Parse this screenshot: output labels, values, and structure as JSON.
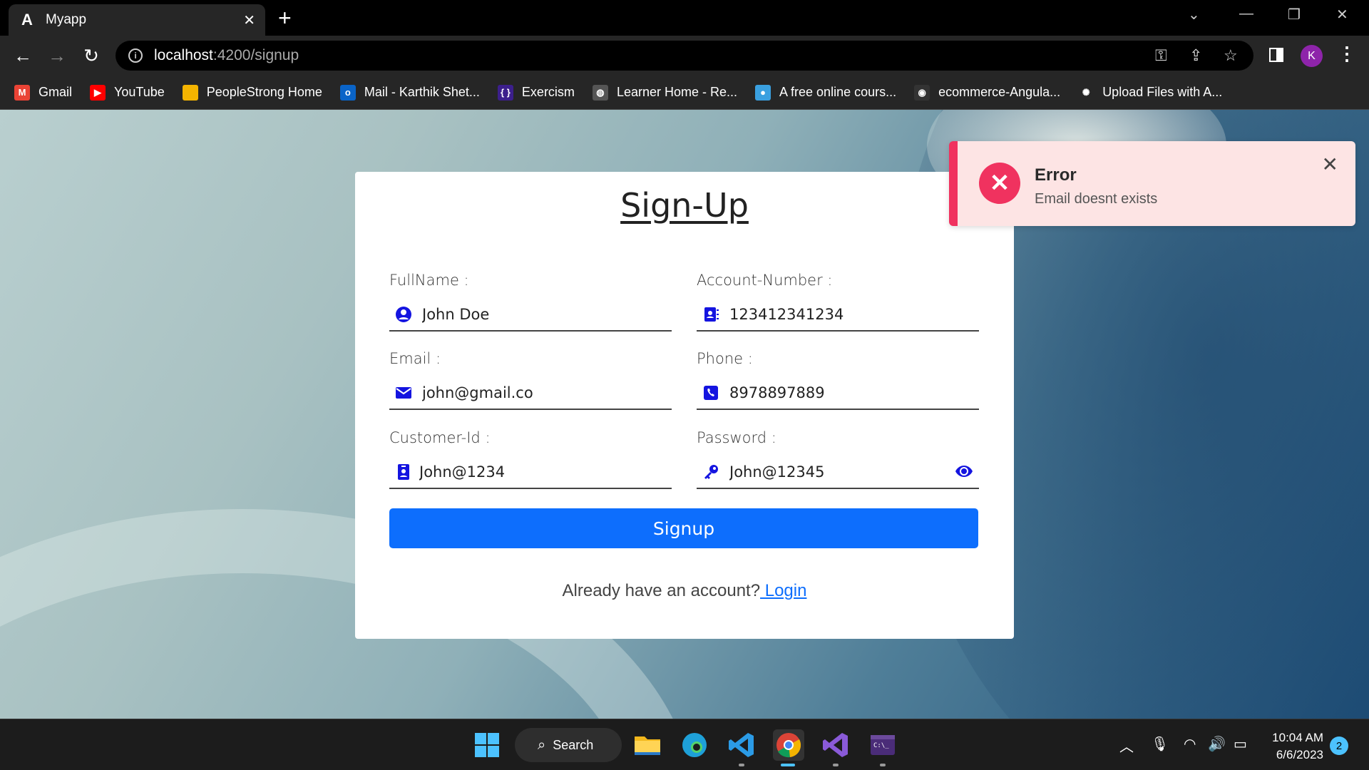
{
  "browser": {
    "tab": {
      "favicon_letter": "A",
      "title": "Myapp",
      "close": "✕"
    },
    "new_tab": "+",
    "url_host": "localhost",
    "url_path": ":4200/signup",
    "profile_initial": "K",
    "bookmarks": [
      {
        "label": "Gmail",
        "icon": "gmail-icon",
        "color": "#ea4335",
        "glyph": "M"
      },
      {
        "label": "YouTube",
        "icon": "youtube-icon",
        "color": "#ff0000",
        "glyph": "▶"
      },
      {
        "label": "PeopleStrong Home",
        "icon": "peoplestrong-icon",
        "color": "#f4b400",
        "glyph": ""
      },
      {
        "label": "Mail - Karthik Shet...",
        "icon": "outlook-icon",
        "color": "#0a64c8",
        "glyph": "o"
      },
      {
        "label": "Exercism",
        "icon": "exercism-icon",
        "color": "#3c1f8c",
        "glyph": "{ }"
      },
      {
        "label": "Learner Home - Re...",
        "icon": "globe-icon",
        "color": "#555555",
        "glyph": "◍"
      },
      {
        "label": "A free online cours...",
        "icon": "course-icon",
        "color": "#3aa0e0",
        "glyph": "●"
      },
      {
        "label": "ecommerce-Angula...",
        "icon": "github-icon",
        "color": "#333333",
        "glyph": "◉"
      },
      {
        "label": "Upload Files with A...",
        "icon": "upload-icon",
        "color": "#262626",
        "glyph": "✺"
      }
    ]
  },
  "form": {
    "title": "Sign-Up",
    "fields": {
      "fullname": {
        "label": "FullName :",
        "value": "John Doe"
      },
      "account": {
        "label": "Account-Number :",
        "value": "123412341234"
      },
      "email": {
        "label": "Email :",
        "value": "john@gmail.co"
      },
      "phone": {
        "label": "Phone :",
        "value": "8978897889"
      },
      "customer": {
        "label": "Customer-Id :",
        "value": "John@1234"
      },
      "password": {
        "label": "Password :",
        "value": "John@12345"
      }
    },
    "submit_label": "Signup",
    "login_prompt": "Already have an account?",
    "login_link": " Login"
  },
  "toast": {
    "title": "Error",
    "message": "Email doesnt exists",
    "accent_color": "#f0325f"
  },
  "taskbar": {
    "search_label": "Search",
    "time": "10:04 AM",
    "date": "6/6/2023",
    "notification_count": "2"
  }
}
